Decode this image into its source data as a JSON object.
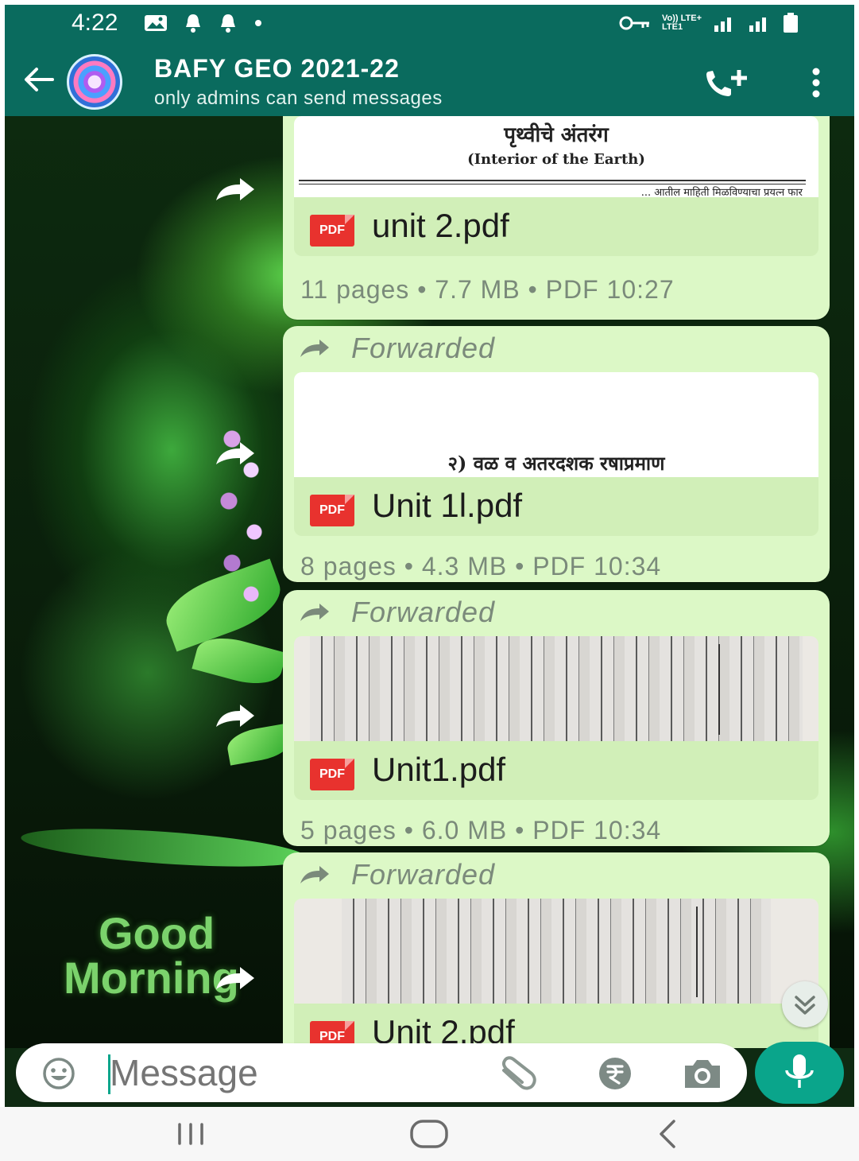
{
  "status_bar": {
    "time": "4:22",
    "network_label": "Vo)) LTE+\nLTE1"
  },
  "header": {
    "title": "BAFY GEO 2021-22",
    "subtitle": "only admins can send messages"
  },
  "messages": [
    {
      "forwarded_label": "",
      "thumb_heading": "पृथ्वीचे अंतरंग",
      "thumb_sub": "(Interior of the Earth)",
      "thumb_line": "... आतील माहिती मिळविण्याचा प्रयत्न फार",
      "pdf_badge": "PDF",
      "file_name": "unit 2.pdf",
      "meta": "11 pages • 7.7 MB • PDF  10:27"
    },
    {
      "forwarded_label": "Forwarded",
      "thumb_heading": "२) वळ व अतरदशक रषाप्रमाण",
      "pdf_badge": "PDF",
      "file_name": "Unit 1l.pdf",
      "meta": "8 pages • 4.3 MB • PDF  10:34"
    },
    {
      "forwarded_label": "Forwarded",
      "pdf_badge": "PDF",
      "file_name": "Unit1.pdf",
      "meta": "5 pages • 6.0 MB • PDF  10:34"
    },
    {
      "forwarded_label": "Forwarded",
      "pdf_badge": "PDF",
      "file_name": "Unit 2.pdf",
      "meta": ""
    }
  ],
  "wallpaper": {
    "text_line1": "Good",
    "text_line2": "Morning"
  },
  "composer": {
    "placeholder": "Message"
  },
  "colors": {
    "header_bg": "#0a6b5e",
    "bubble_bg": "#dcf8c6",
    "accent": "#0aa58b",
    "pdf_red": "#e8322e"
  },
  "icons": {
    "back": "arrow-left-icon",
    "call": "add-call-icon",
    "menu": "kebab-menu-icon",
    "forward": "share-forward-icon",
    "emoji": "emoji-icon",
    "attach": "paperclip-icon",
    "pay": "rupee-icon",
    "camera": "camera-icon",
    "mic": "mic-icon",
    "scroll_down": "double-chevron-down-icon"
  }
}
